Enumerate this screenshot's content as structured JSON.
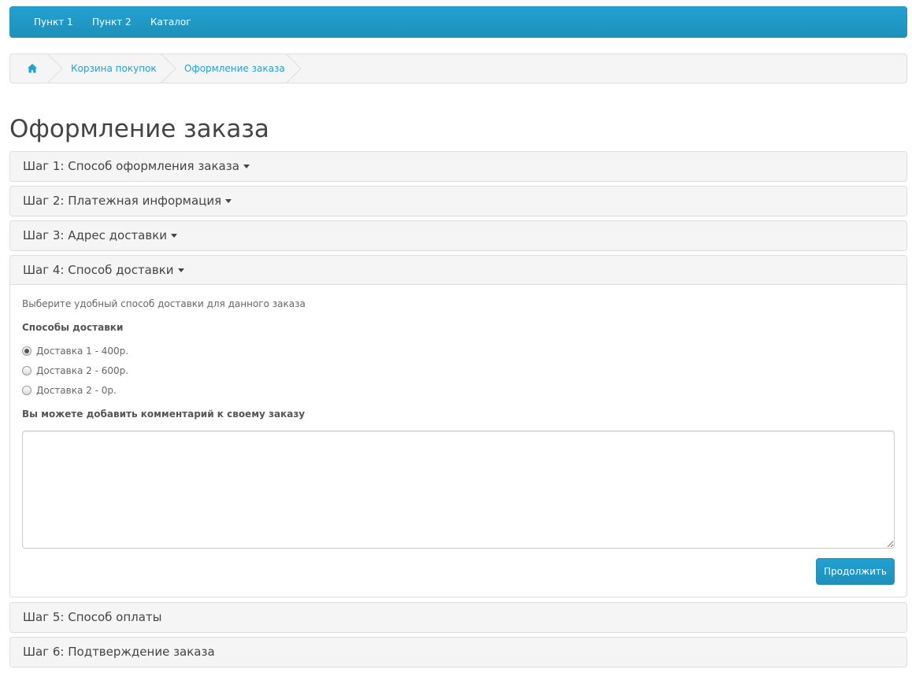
{
  "nav": {
    "items": [
      "Пункт 1",
      "Пункт 2",
      "Каталог"
    ]
  },
  "breadcrumb": {
    "items": [
      "Корзина покупок",
      "Оформление заказа"
    ],
    "home_icon": "home-icon"
  },
  "page": {
    "title": "Оформление заказа"
  },
  "steps": [
    "Шаг 1: Способ оформления заказа",
    "Шаг 2: Платежная информация",
    "Шаг 3: Адрес доставки",
    "Шаг 4: Способ доставки",
    "Шаг 5: Способ оплаты",
    "Шаг 6: Подтверждение заказа"
  ],
  "shipping": {
    "description": "Выберите удобный способ доставки для данного заказа",
    "methods_label": "Способы доставки",
    "methods": [
      "Доставка 1 - 400р.",
      "Доставка 2 - 600р.",
      "Доставка 2 - 0р."
    ],
    "selected_index": 0,
    "comment_label": "Вы можете добавить комментарий к своему заказу",
    "comment_value": "",
    "continue_label": "Продолжить"
  },
  "colors": {
    "accent": "#229ac8",
    "link": "#23a1d1",
    "panel_bg": "#f5f5f5",
    "border": "#dddddd"
  }
}
